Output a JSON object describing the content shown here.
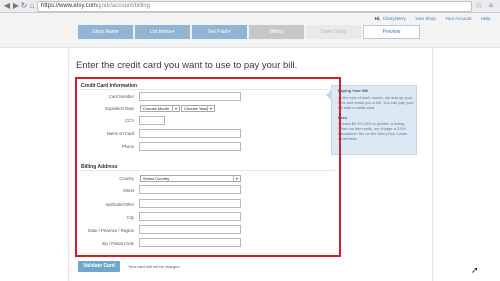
{
  "browser": {
    "back_icon": "back-arrow-icon",
    "forward_icon": "forward-arrow-icon",
    "reload_icon": "reload-icon",
    "home_icon": "home-icon",
    "url_host": "https://www.etsy.com",
    "url_path": "/your/account/billing"
  },
  "header": {
    "greeting": "Hi,",
    "username": "CherylJerry",
    "links": [
      "Your Shop",
      "Your Account",
      "Help"
    ]
  },
  "steps": [
    {
      "label": "Shop Name",
      "state": "done",
      "check": ""
    },
    {
      "label": "List Items",
      "state": "done",
      "check": "✔"
    },
    {
      "label": "Get Paid",
      "state": "done",
      "check": "✔"
    },
    {
      "label": "Billing",
      "state": "current",
      "check": ""
    },
    {
      "label": "Open Shop",
      "state": "todo",
      "check": ""
    },
    {
      "label": "Preview",
      "state": "preview",
      "check": ""
    }
  ],
  "page": {
    "heading": "Enter the credit card you want to use to pay your bill."
  },
  "credit_card": {
    "title": "Credit Card Information",
    "card_number_label": "Card Number",
    "expiration_label": "Expiration Date",
    "month_select": "Choose Month",
    "year_select": "Choose Year",
    "ccv_label": "CCV",
    "name_label": "Name on Card",
    "phone_label": "Phone"
  },
  "billing": {
    "title": "Billing Address",
    "country_label": "Country",
    "country_select": "Select Country",
    "street_label": "Street",
    "apt_label": "Apt/Suite/Other",
    "city_label": "City",
    "state_label": "State / Province / Region",
    "zip_label": "Zip / Postal Code"
  },
  "help": {
    "title1": "Paying Your Bill",
    "text1": "At the end of each month, we add up your fees and email you a bill. You can pay your bill with a credit card.",
    "title2": "Fees",
    "text2": "It costs $0.20 USD to publish a listing. When an item sells, we charge a 3.5% transaction fee on the item price.",
    "link": "Learn about fees."
  },
  "footer": {
    "validate_label": "Validate Card",
    "note": "Your card will not be charged"
  },
  "colors": {
    "accent": "#6fa8cf",
    "highlight": "#d41f2b",
    "step_done": "#8fb4d4"
  }
}
